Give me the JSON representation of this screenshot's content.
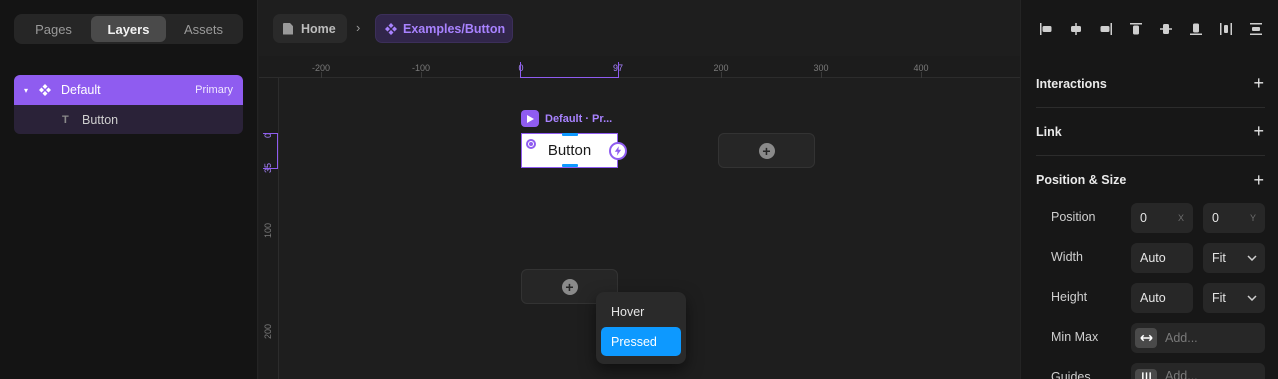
{
  "left_panel": {
    "tabs": [
      {
        "label": "Pages",
        "active": false
      },
      {
        "label": "Layers",
        "active": true
      },
      {
        "label": "Assets",
        "active": false
      }
    ],
    "layers": {
      "primary": {
        "name": "Default",
        "badge": "Primary"
      },
      "child": {
        "name": "Button"
      }
    }
  },
  "breadcrumb": {
    "home": "Home",
    "separator": "›",
    "current": "Examples/Button"
  },
  "rulers": {
    "top_ticks": [
      "-200",
      "-100",
      "0",
      "97",
      "200",
      "300",
      "400"
    ],
    "left_ticks": [
      "0",
      "35",
      "100",
      "200"
    ]
  },
  "canvas": {
    "frame_label": "Default · Pr...",
    "button_text": "Button",
    "variant_menu": [
      "Hover",
      "Pressed"
    ],
    "selected_variant": "Pressed"
  },
  "right_panel": {
    "sections": {
      "interactions": "Interactions",
      "link": "Link",
      "position_size": "Position & Size"
    },
    "position": {
      "label": "Position",
      "x": "0",
      "x_axis": "X",
      "y": "0",
      "y_axis": "Y"
    },
    "width": {
      "label": "Width",
      "value": "Auto",
      "mode": "Fit"
    },
    "height": {
      "label": "Height",
      "value": "Auto",
      "mode": "Fit"
    },
    "min_max": {
      "label": "Min Max",
      "placeholder": "Add..."
    },
    "guides": {
      "label": "Guides",
      "placeholder": "Add..."
    }
  },
  "colors": {
    "accent_purple": "#8f5cf0",
    "selection_blue": "#0d99ff",
    "panel_bg": "#171717"
  }
}
